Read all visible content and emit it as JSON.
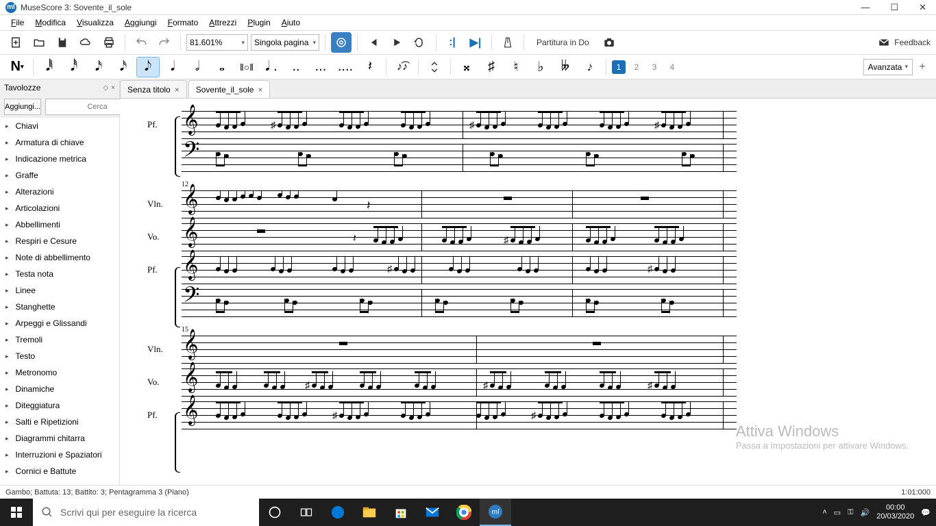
{
  "window": {
    "title": "MuseScore 3: Sovente_il_sole",
    "logo_text": "mſ"
  },
  "menus": [
    "File",
    "Modifica",
    "Visualizza",
    "Aggiungi",
    "Formato",
    "Attrezzi",
    "Plugin",
    "Aiuto"
  ],
  "toolbar1": {
    "zoom": "81.601%",
    "pagemode": "Singola pagina",
    "concert_pitch": "Partitura in Do",
    "feedback": "Feedback"
  },
  "toolbar2": {
    "voices": [
      "1",
      "2",
      "3",
      "4"
    ],
    "workspace": "Avanzata"
  },
  "palette": {
    "title": "Tavolozze",
    "add_btn": "Aggiungi...",
    "search_ph": "Cerca",
    "items": [
      "Chiavi",
      "Armatura di chiave",
      "Indicazione metrica",
      "Graffe",
      "Alterazioni",
      "Articolazioni",
      "Abbellimenti",
      "Respiri e Cesure",
      "Note di abbellimento",
      "Testa nota",
      "Linee",
      "Stanghette",
      "Arpeggi e Glissandi",
      "Tremoli",
      "Testo",
      "Metronomo",
      "Dinamiche",
      "Diteggiatura",
      "Salti e Ripetizioni",
      "Diagrammi chitarra",
      "Interruzioni e Spaziatori",
      "Cornici e Battute"
    ]
  },
  "tabs": [
    {
      "label": "Senza titolo",
      "active": false
    },
    {
      "label": "Sovente_il_sole",
      "active": true
    }
  ],
  "score": {
    "instruments": {
      "vln": "Vln.",
      "vo": "Vo.",
      "pf": "Pf."
    },
    "systems": [
      {
        "measure_start": null,
        "staves": [
          "pf_treble",
          "pf_bass"
        ],
        "label": "Pf."
      },
      {
        "measure_start": "12",
        "staves": [
          "vln",
          "vo",
          "pf_treble",
          "pf_bass"
        ]
      },
      {
        "measure_start": "15",
        "staves": [
          "vln",
          "vo",
          "pf_treble",
          "pf_bass"
        ]
      }
    ]
  },
  "watermark": {
    "l1": "Attiva Windows",
    "l2": "Passa a Impostazioni per attivare Windows."
  },
  "statusbar": {
    "left": "Gambo;  Battuta: 13; Battito: 3; Pentagramma 3 (Piano)",
    "right": "1:01:000"
  },
  "taskbar": {
    "search_ph": "Scrivi qui per eseguire la ricerca",
    "time": "00:00",
    "date": "20/03/2020"
  }
}
